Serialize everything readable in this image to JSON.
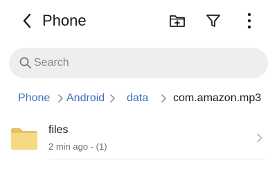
{
  "header": {
    "title": "Phone",
    "back_icon": "chevron-left-icon",
    "actions": [
      {
        "name": "new-folder",
        "icon": "folder-plus-icon"
      },
      {
        "name": "filter",
        "icon": "filter-icon"
      },
      {
        "name": "more-options",
        "icon": "more-vertical-icon"
      }
    ]
  },
  "search": {
    "placeholder": "Search",
    "value": ""
  },
  "breadcrumb": {
    "items": [
      {
        "label": "Phone"
      },
      {
        "label": "Android"
      },
      {
        "label": "data"
      },
      {
        "label": "com.amazon.mp3"
      }
    ]
  },
  "files": [
    {
      "name": "files",
      "meta": "2 min ago - (1)",
      "icon": "folder-icon"
    }
  ],
  "colors": {
    "link": "#3a6fbf",
    "folder": "#f2d27a",
    "search_bg": "#eeeeee",
    "text": "#1a1a1a",
    "secondary_text": "#6e6e6e"
  }
}
